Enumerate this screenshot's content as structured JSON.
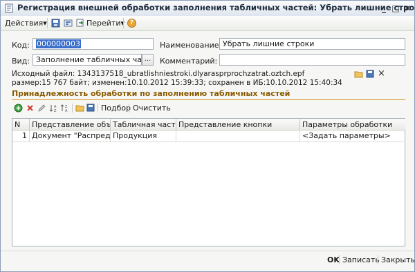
{
  "window": {
    "title": "Регистрация внешней обработки заполнения табличных частей: Убрать лишние строки",
    "controls": {
      "minimize": "_",
      "maximize": "□",
      "close": "✕"
    }
  },
  "toolbar": {
    "actions": "Действия",
    "goto": "Перейти",
    "dropdown_arrow": "▾",
    "help": "?"
  },
  "form": {
    "code_label": "Код:",
    "code_value": "000000003",
    "name_label": "Наименование:",
    "name_value": "Убрать лишние строки",
    "kind_label": "Вид:",
    "kind_value": "Заполнение табличных частей",
    "kind_select": "...",
    "comment_label": "Комментарий:",
    "comment_value": ""
  },
  "file_info": {
    "source_line": "Исходный файл: 1343137518_ubratlishniestroki.dlyarasprprochzatrat.oztch.epf",
    "size_line": "размер:15 767 байт; изменен:10.10.2012 15:39:33; сохранен в ИБ:10.10.2012 15:40:34",
    "delete_symbol": "×"
  },
  "section": {
    "title": "Принадлежность обработки по заполнению табличных частей",
    "select_label": "Подбор",
    "clear_label": "Очистить"
  },
  "table": {
    "headers": [
      "N",
      "Представление объе...",
      "Табличная часть",
      "Представление кнопки",
      "Параметры обработки"
    ],
    "rows": [
      [
        "1",
        "Документ \"Распредел...",
        "Продукция",
        "",
        "<Задать параметры>"
      ]
    ]
  },
  "footer": {
    "ok": "OK",
    "save": "Записать",
    "close": "Закрыть"
  }
}
